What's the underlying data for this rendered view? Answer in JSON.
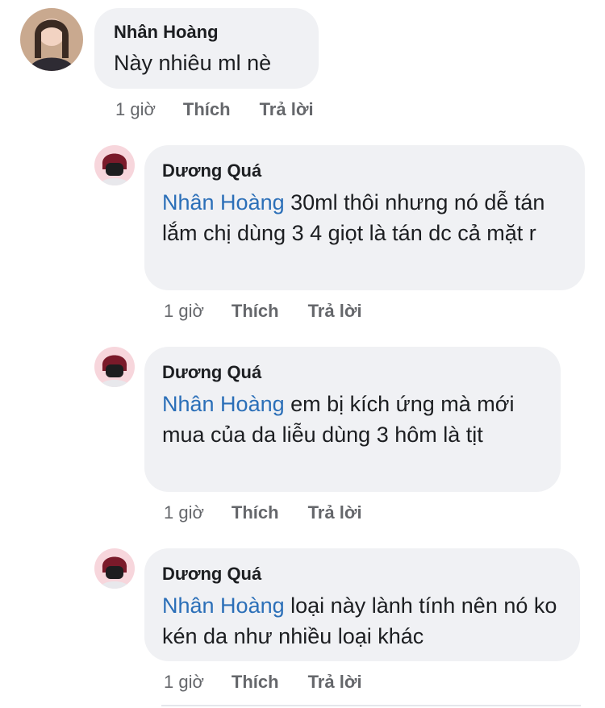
{
  "comments": [
    {
      "author": "Nhân Hoàng",
      "mention": "",
      "text": "Này nhiêu ml nè",
      "time": "1 giờ",
      "like": "Thích",
      "reply": "Trả lời"
    },
    {
      "author": "Dương Quá",
      "mention": "Nhân Hoàng",
      "text": "30ml thôi nhưng nó dễ tán lắm chị dùng  3 4 giọt là tán dc cả mặt r",
      "time": "1 giờ",
      "like": "Thích",
      "reply": "Trả lời"
    },
    {
      "author": "Dương Quá",
      "mention": "Nhân Hoàng",
      "text": "em bị kích ứng mà mới mua của da liễu dùng 3 hôm là tịt",
      "time": "1 giờ",
      "like": "Thích",
      "reply": "Trả lời"
    },
    {
      "author": "Dương Quá",
      "mention": "Nhân Hoàng",
      "text": "loại này lành tính nên nó ko kén da như nhiều loại khác",
      "time": "1 giờ",
      "like": "Thích",
      "reply": "Trả lời"
    }
  ]
}
